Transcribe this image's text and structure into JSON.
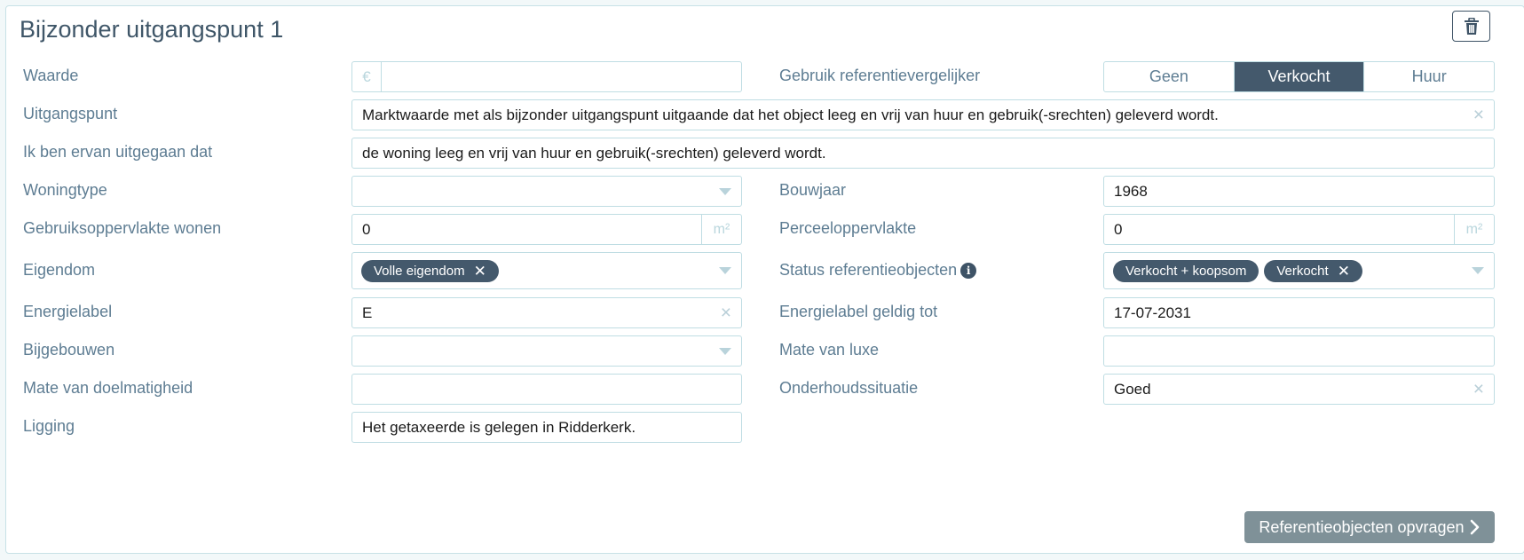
{
  "title": "Bijzonder uitgangspunt 1",
  "icons": {
    "delete": "trash-icon",
    "info": "info-icon",
    "submit_chevron": "chevron-right-icon"
  },
  "fields": {
    "waarde": {
      "label": "Waarde",
      "prefix": "€",
      "value": ""
    },
    "referentie": {
      "label": "Gebruik referentievergelijker",
      "options": [
        "Geen",
        "Verkocht",
        "Huur"
      ],
      "selected": "Verkocht"
    },
    "uitgangspunt": {
      "label": "Uitgangspunt",
      "value": "Marktwaarde met als bijzonder uitgangspunt uitgaande dat het object leeg en vrij van huur en gebruik(-srechten) geleverd wordt."
    },
    "ervan_uitgegaan": {
      "label": "Ik ben ervan uitgegaan dat",
      "value": "de woning leeg en vrij van huur en gebruik(-srechten) geleverd wordt."
    },
    "woningtype": {
      "label": "Woningtype",
      "value": ""
    },
    "bouwjaar": {
      "label": "Bouwjaar",
      "value": "1968"
    },
    "gebruiksoppervlakte": {
      "label": "Gebruiksoppervlakte wonen",
      "value": "0",
      "unit": "m²"
    },
    "perceeloppervlakte": {
      "label": "Perceeloppervlakte",
      "value": "0",
      "unit": "m²"
    },
    "eigendom": {
      "label": "Eigendom",
      "tags": [
        "Volle eigendom"
      ]
    },
    "status_referentie": {
      "label": "Status referentieobjecten",
      "tags": [
        "Verkocht + koopsom",
        "Verkocht"
      ]
    },
    "energielabel": {
      "label": "Energielabel",
      "value": "E"
    },
    "energielabel_geldig": {
      "label": "Energielabel geldig tot",
      "value": "17-07-2031"
    },
    "bijgebouwen": {
      "label": "Bijgebouwen",
      "value": ""
    },
    "mate_luxe": {
      "label": "Mate van luxe",
      "value": ""
    },
    "mate_doelmatigheid": {
      "label": "Mate van doelmatigheid",
      "value": ""
    },
    "onderhoud": {
      "label": "Onderhoudssituatie",
      "value": "Goed"
    },
    "ligging": {
      "label": "Ligging",
      "value": "Het getaxeerde is gelegen in Ridderkerk."
    }
  },
  "submit_label": "Referentieobjecten opvragen",
  "colors": {
    "accent": "#44596c",
    "border": "#bfdde3",
    "label": "#5e7d93",
    "button_disabled": "#7f9198"
  }
}
